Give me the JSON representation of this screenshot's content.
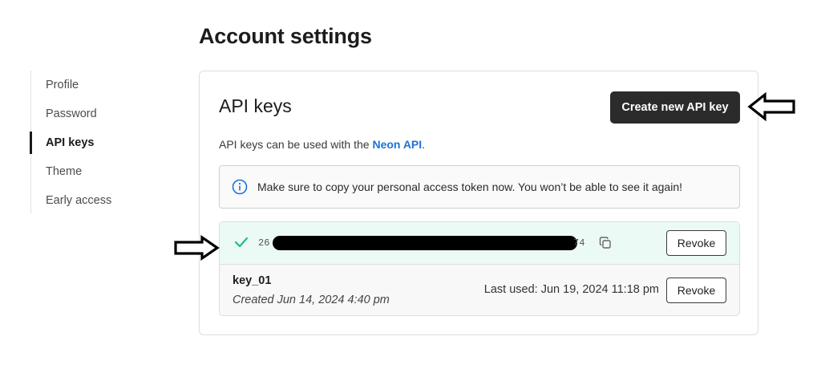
{
  "page": {
    "title": "Account settings"
  },
  "sidebar": {
    "items": [
      {
        "label": "Profile",
        "active": false
      },
      {
        "label": "Password",
        "active": false
      },
      {
        "label": "API keys",
        "active": true
      },
      {
        "label": "Theme",
        "active": false
      },
      {
        "label": "Early access",
        "active": false
      }
    ]
  },
  "api_keys": {
    "title": "API keys",
    "create_label": "Create new API key",
    "description_prefix": "API keys can be used with the ",
    "description_link": "Neon API",
    "description_suffix": ".",
    "notice": "Make sure to copy your personal access token now. You won’t be able to see it again!",
    "new_key": {
      "token_start": "26",
      "token_end": "74",
      "revoke_label": "Revoke"
    },
    "keys": [
      {
        "name": "key_01",
        "created": "Created Jun 14, 2024 4:40 pm",
        "last_used": "Last used: Jun 19, 2024 11:18 pm",
        "revoke_label": "Revoke"
      }
    ]
  },
  "colors": {
    "accent_link": "#1d72d8",
    "success": "#1bbf8c",
    "new_key_bg": "#ecfaf5",
    "primary_button": "#2b2b2b"
  },
  "icons": {
    "info": "info-icon",
    "check": "check-icon",
    "copy": "copy-icon",
    "arrow": "hollow-arrow-icon"
  }
}
